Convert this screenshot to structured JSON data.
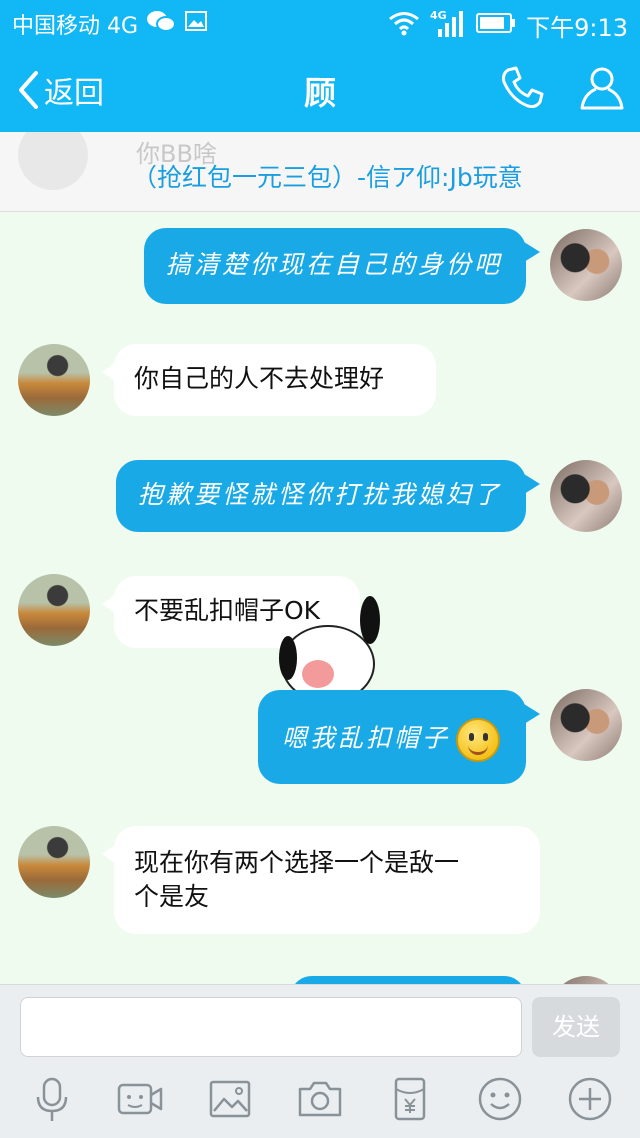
{
  "status_bar": {
    "carrier": "中国移动 4G",
    "network": "4G",
    "time": "下午9:13"
  },
  "header": {
    "back_label": "返回",
    "title": "顾"
  },
  "pinned": {
    "sender": "你BB啥",
    "text": "（抢红包一元三包）-信ア仰:Jb玩意"
  },
  "messages": [
    {
      "side": "out",
      "text": "搞清楚你现在自己的身份吧"
    },
    {
      "side": "in",
      "text": "你自己的人不去处理好"
    },
    {
      "side": "out",
      "text": "抱歉要怪就怪你打扰我媳妇了"
    },
    {
      "side": "in",
      "text": "不要乱扣帽子OK"
    },
    {
      "side": "out",
      "text": "嗯我乱扣帽子",
      "emoji": "smiley-emoji"
    },
    {
      "side": "in",
      "text_line1": "现在你有两个选择一个是敌一",
      "text_line2": "个是友"
    }
  ],
  "input": {
    "value": "",
    "placeholder": "",
    "send_label": "发送"
  },
  "toolbar_icons": [
    "microphone-icon",
    "video-call-icon",
    "image-icon",
    "camera-icon",
    "red-packet-icon",
    "emoji-icon",
    "plus-icon"
  ],
  "colors": {
    "accent": "#12b7f5",
    "outgoing_bubble": "#19a9e6",
    "incoming_bubble": "#ffffff",
    "chat_background": "#eefbee",
    "notice_text": "#1a9ee0"
  }
}
